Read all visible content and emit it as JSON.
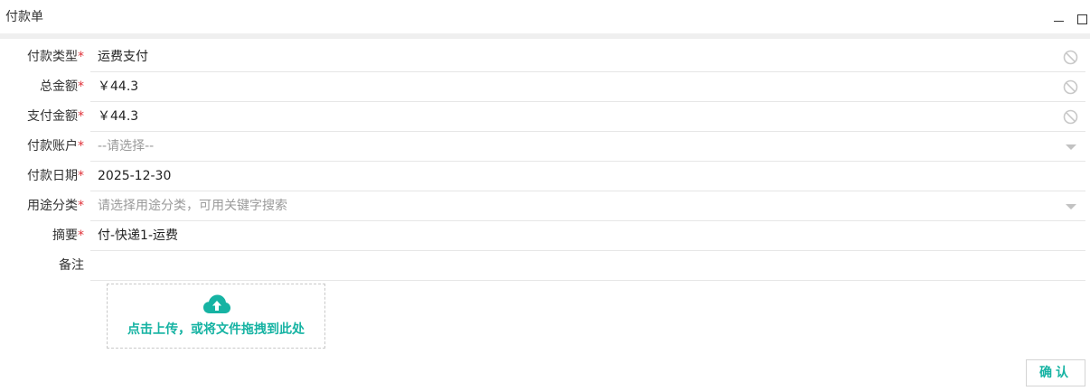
{
  "window": {
    "title": "付款单",
    "minimize_icon": "minimize-icon",
    "maximize_icon": "maximize-icon"
  },
  "form": {
    "fields": [
      {
        "label": "付款类型",
        "required": "*",
        "value": "运费支付",
        "placeholder": "",
        "control": "text-disabled",
        "icon": "disabled-icon"
      },
      {
        "label": "总金额",
        "required": "*",
        "value": "￥44.3",
        "placeholder": "",
        "control": "text-disabled",
        "icon": "disabled-icon"
      },
      {
        "label": "支付金额",
        "required": "*",
        "value": "￥44.3",
        "placeholder": "",
        "control": "text-disabled",
        "icon": "disabled-icon"
      },
      {
        "label": "付款账户",
        "required": "*",
        "value": "",
        "placeholder": "--请选择--",
        "control": "select",
        "icon": "chevron-down-icon"
      },
      {
        "label": "付款日期",
        "required": "*",
        "value": "2025-12-30",
        "placeholder": "",
        "control": "date",
        "icon": ""
      },
      {
        "label": "用途分类",
        "required": "*",
        "value": "",
        "placeholder": "请选择用途分类，可用关键字搜索",
        "control": "select",
        "icon": "chevron-down-icon"
      },
      {
        "label": "摘要",
        "required": "*",
        "value": "付-快递1-运费",
        "placeholder": "",
        "control": "text",
        "icon": ""
      },
      {
        "label": "备注",
        "required": "",
        "value": "",
        "placeholder": "",
        "control": "text",
        "icon": ""
      }
    ]
  },
  "upload": {
    "text": "点击上传，或将文件拖拽到此处",
    "icon": "cloud-upload-icon",
    "color": "#16b3a3"
  },
  "actions": {
    "confirm_label": "确认"
  },
  "colors": {
    "accent": "#16b3a3",
    "required": "#e0323a"
  }
}
